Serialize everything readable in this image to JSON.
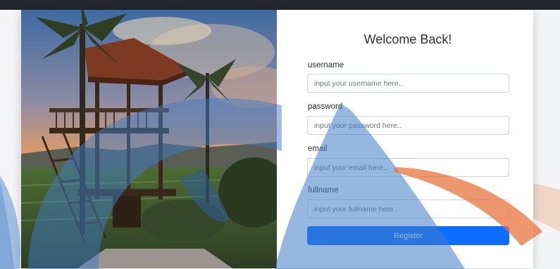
{
  "form": {
    "title": "Welcome Back!",
    "fields": [
      {
        "label": "username",
        "placeholder": "input your username here.."
      },
      {
        "label": "password",
        "placeholder": "input your password here.."
      },
      {
        "label": "email",
        "placeholder": "input your email here.."
      },
      {
        "label": "fullname",
        "placeholder": "input your fullname here.."
      }
    ],
    "submit_label": "Register"
  },
  "colors": {
    "primary_button": "#0d6efd",
    "watermark_blue": "#3f7cc6",
    "watermark_orange": "#e8743f",
    "top_bar": "#23262b"
  },
  "icons": {
    "photo": "gazebo-sunset-photo",
    "watermark": "logo-watermark"
  }
}
